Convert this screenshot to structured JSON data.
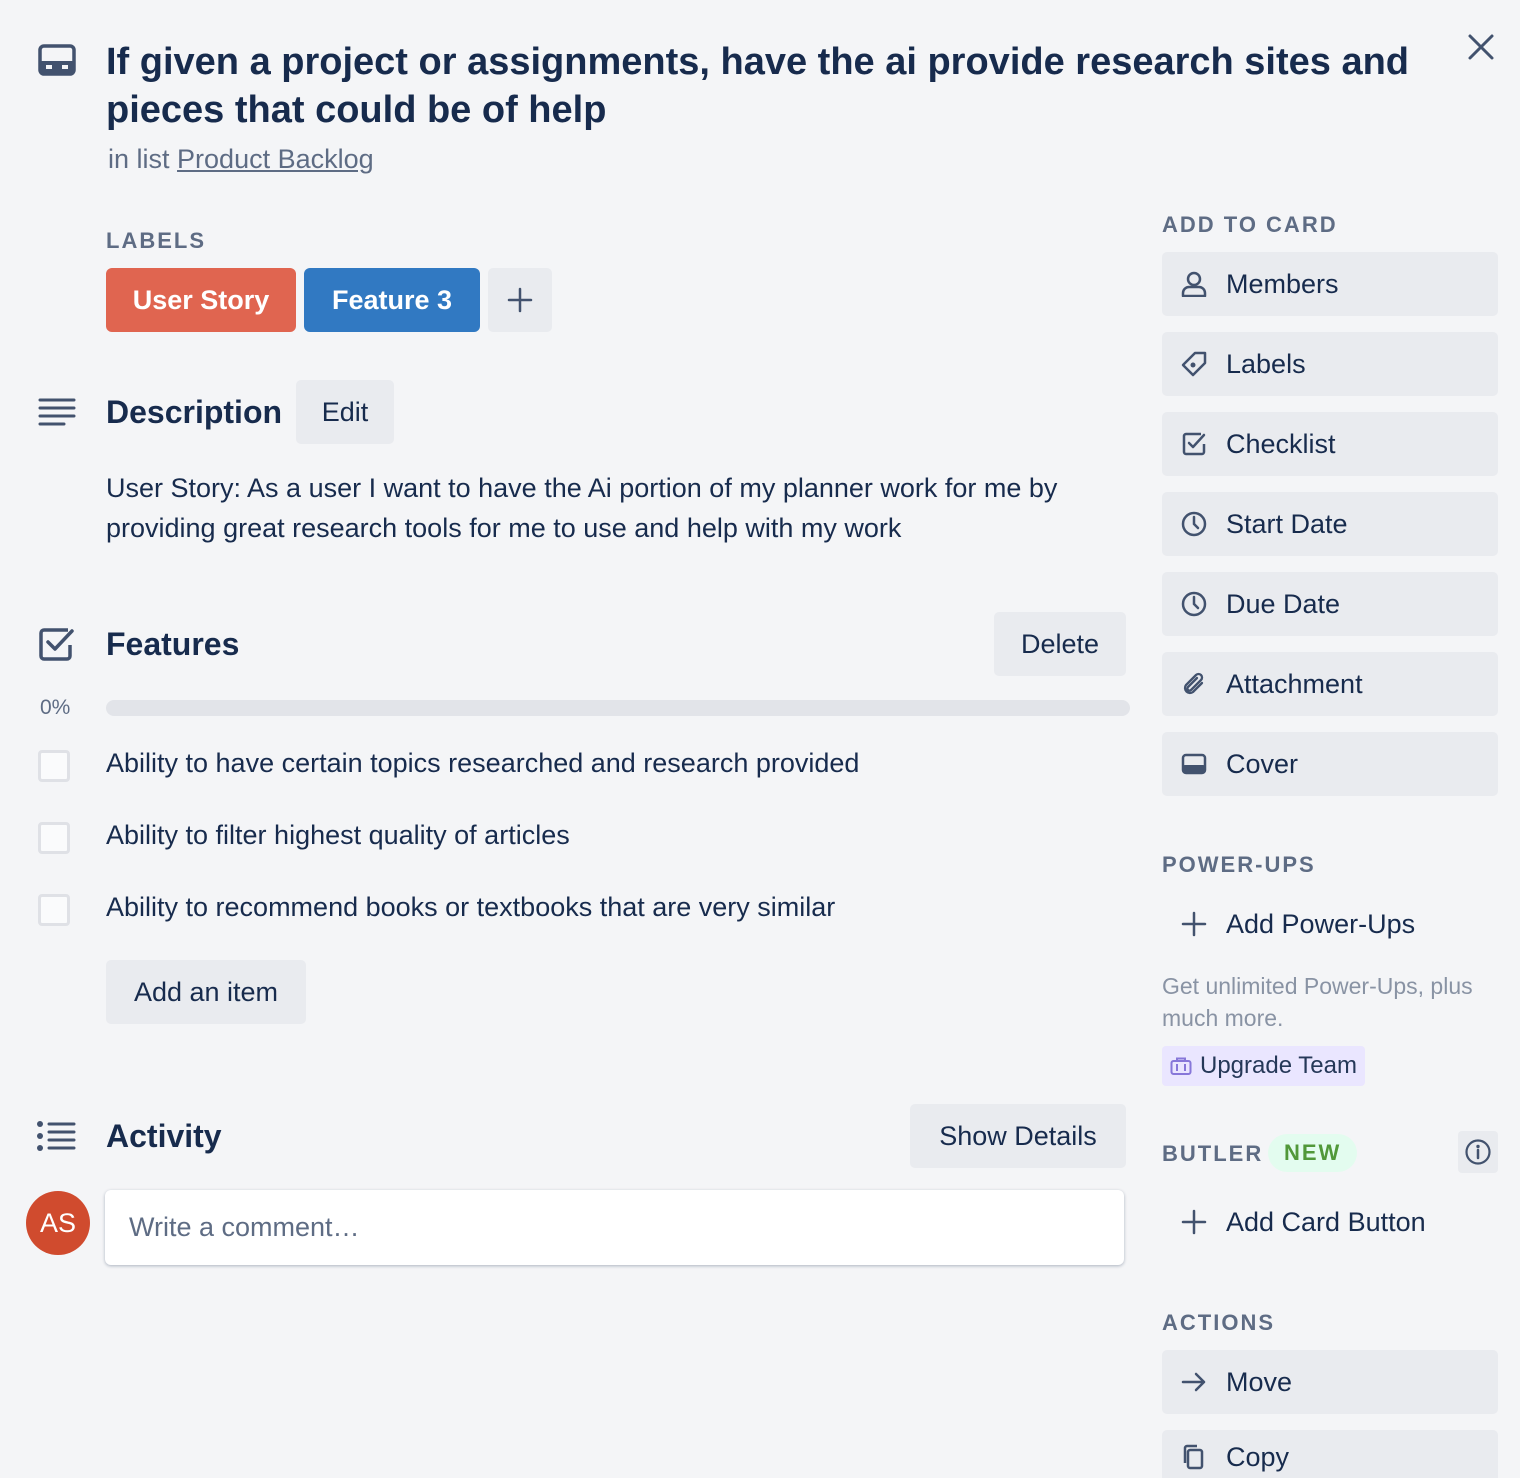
{
  "card": {
    "title": "If given a project or assignments, have the ai provide research sites and pieces that could be of help",
    "in_list_prefix": "in list",
    "list_name": "Product Backlog"
  },
  "labels": {
    "heading": "LABELS",
    "items": [
      {
        "text": "User Story",
        "color": "#e06550"
      },
      {
        "text": "Feature 3",
        "color": "#3179c2"
      }
    ]
  },
  "description": {
    "heading": "Description",
    "edit_label": "Edit",
    "text": "User Story: As a user I want to have the Ai portion of my planner work for me by providing great research tools for me to use and help with my work"
  },
  "checklist": {
    "heading": "Features",
    "delete_label": "Delete",
    "progress_text": "0%",
    "progress": 0,
    "items": [
      {
        "text": "Ability to have certain topics researched and research provided",
        "checked": false
      },
      {
        "text": "Ability to filter highest quality of articles",
        "checked": false
      },
      {
        "text": "Ability to recommend books or textbooks that are very similar",
        "checked": false
      }
    ],
    "add_item_label": "Add an item"
  },
  "activity": {
    "heading": "Activity",
    "show_details_label": "Show Details",
    "avatar_initials": "AS",
    "comment_placeholder": "Write a comment…"
  },
  "sidebar": {
    "add_to_card_heading": "ADD TO CARD",
    "add_to_card": [
      {
        "label": "Members",
        "icon": "person-icon"
      },
      {
        "label": "Labels",
        "icon": "tag-icon"
      },
      {
        "label": "Checklist",
        "icon": "checkbox-icon"
      },
      {
        "label": "Start Date",
        "icon": "clock-icon"
      },
      {
        "label": "Due Date",
        "icon": "clock-icon"
      },
      {
        "label": "Attachment",
        "icon": "paperclip-icon"
      },
      {
        "label": "Cover",
        "icon": "cover-icon"
      }
    ],
    "powerups_heading": "POWER-UPS",
    "add_powerups_label": "Add Power-Ups",
    "promo_text": "Get unlimited Power-Ups, plus much more.",
    "upgrade_label": "Upgrade Team",
    "butler_heading": "BUTLER",
    "butler_badge": "NEW",
    "add_card_button_label": "Add Card Button",
    "actions_heading": "ACTIONS",
    "actions": [
      {
        "label": "Move",
        "icon": "arrow-right-icon"
      },
      {
        "label": "Copy",
        "icon": "copy-icon"
      }
    ]
  },
  "colors": {
    "text": "#172b4d",
    "muted": "#5e6c84",
    "button_bg": "#e9ebef",
    "background": "#f4f5f7"
  }
}
